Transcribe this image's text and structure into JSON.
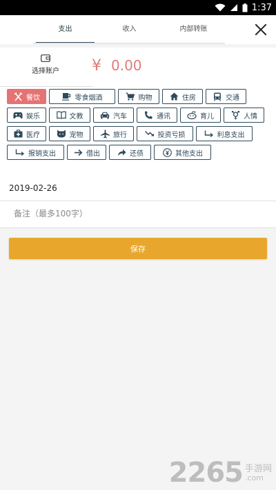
{
  "status_bar": {
    "time": "1:37"
  },
  "tabs": [
    {
      "label": "支出",
      "active": true
    },
    {
      "label": "收入",
      "active": false
    },
    {
      "label": "内部转账",
      "active": false
    }
  ],
  "account": {
    "label": "选择账户",
    "icon": "wallet-icon"
  },
  "amount": {
    "currency": "¥",
    "value": "0.00"
  },
  "categories": [
    [
      {
        "label": "餐饮",
        "icon": "fork-knife-icon",
        "selected": true
      },
      {
        "label": "零食烟酒",
        "icon": "cup-icon"
      },
      {
        "label": "购物",
        "icon": "cart-icon"
      },
      {
        "label": "住房",
        "icon": "house-icon"
      },
      {
        "label": "交通",
        "icon": "bus-icon"
      }
    ],
    [
      {
        "label": "娱乐",
        "icon": "gamepad-icon"
      },
      {
        "label": "文教",
        "icon": "book-icon"
      },
      {
        "label": "汽车",
        "icon": "car-icon"
      },
      {
        "label": "通讯",
        "icon": "phone-icon"
      },
      {
        "label": "育儿",
        "icon": "baby-icon"
      },
      {
        "label": "人情",
        "icon": "gender-icon"
      }
    ],
    [
      {
        "label": "医疗",
        "icon": "medkit-icon"
      },
      {
        "label": "宠物",
        "icon": "pet-icon"
      },
      {
        "label": "旅行",
        "icon": "plane-icon"
      },
      {
        "label": "投资亏损",
        "icon": "trend-down-icon"
      },
      {
        "label": "利息支出",
        "icon": "arrow-turn-icon"
      }
    ],
    [
      {
        "label": "报销支出",
        "icon": "arrow-turn-icon"
      },
      {
        "label": "借出",
        "icon": "arrow-right-icon"
      },
      {
        "label": "还债",
        "icon": "share-icon"
      },
      {
        "label": "其他支出",
        "icon": "yen-circle-icon"
      }
    ]
  ],
  "date": "2019-02-26",
  "note": {
    "placeholder": "备注（最多100字）",
    "value": ""
  },
  "save_label": "保存",
  "colors": {
    "accent": "#2e4756",
    "selected": "#e57373",
    "save": "#e8a72c",
    "amount": "#e27a7a"
  },
  "watermark": {
    "number": "2265",
    "line1": "手游网",
    "line2": ".com"
  }
}
